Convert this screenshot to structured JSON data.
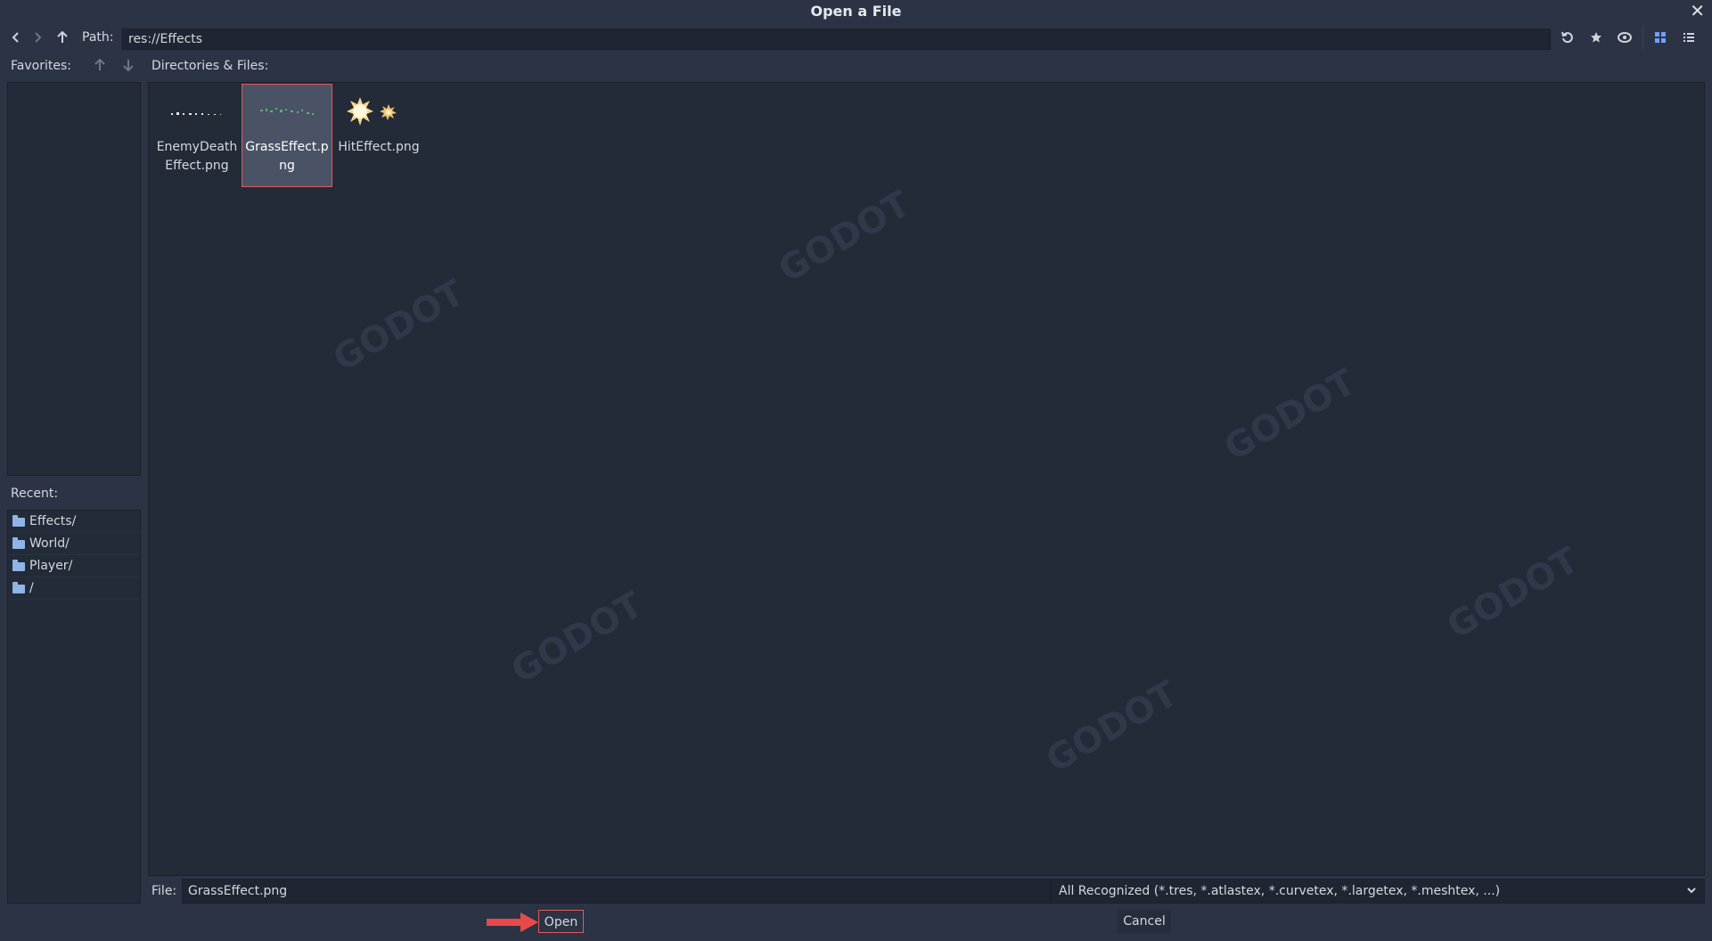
{
  "window": {
    "title": "Open a File"
  },
  "toolbar": {
    "path_label": "Path:",
    "path_value": "res://Effects"
  },
  "favorites": {
    "label": "Favorites:"
  },
  "recent": {
    "label": "Recent:",
    "items": [
      "Effects/",
      "World/",
      "Player/",
      "/"
    ]
  },
  "files": {
    "label": "Directories & Files:",
    "items": [
      {
        "name": "EnemyDeathEffect.png",
        "selected": false
      },
      {
        "name": "GrassEffect.png",
        "selected": true
      },
      {
        "name": "HitEffect.png",
        "selected": false
      }
    ]
  },
  "footer": {
    "file_label": "File:",
    "file_value": "GrassEffect.png",
    "filter_value": "All Recognized (*.tres, *.atlastex, *.curvetex, *.largetex, *.meshtex, ...)",
    "open_label": "Open",
    "cancel_label": "Cancel"
  },
  "icons": {
    "back": "chevron-left-icon",
    "forward": "chevron-right-icon",
    "up": "arrow-up-icon",
    "refresh": "refresh-icon",
    "favorite": "star-icon",
    "hidden": "eye-icon",
    "grid_view": "grid-icon",
    "list_view": "list-icon",
    "close": "close-icon",
    "move_up": "arrow-up-icon",
    "move_down": "arrow-down-icon",
    "folder": "folder-icon",
    "dropdown": "chevron-down-icon",
    "annotation": "red-arrow"
  },
  "colors": {
    "background": "#2c3345",
    "panel": "#232a38",
    "selection_border": "#e05a5a",
    "accent": "#70a0ff"
  }
}
